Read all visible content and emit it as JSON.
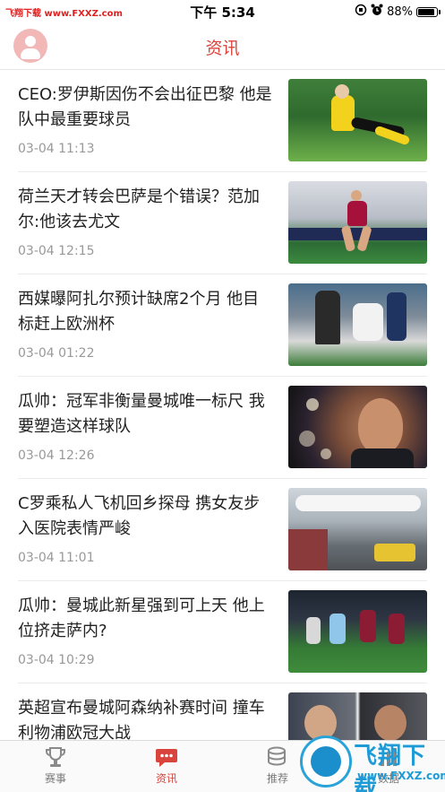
{
  "status_bar": {
    "watermark": "飞翔下载 www.FXXZ.com",
    "time": "下午 5:34",
    "battery": "88%",
    "battery_level": 0.88
  },
  "header": {
    "title": "资讯",
    "avatar_icon": "user-avatar-icon"
  },
  "news": [
    {
      "title": "CEO:罗伊斯因伤不会出征巴黎 他是队中最重要球员",
      "time": "03-04 11:13"
    },
    {
      "title": "荷兰天才转会巴萨是个错误？范加尔:他该去尤文",
      "time": "03-04 12:15"
    },
    {
      "title": "西媒曝阿扎尔预计缺席2个月 他目标赶上欧洲杯",
      "time": "03-04 01:22"
    },
    {
      "title": "瓜帅：冠军非衡量曼城唯一标尺 我要塑造这样球队",
      "time": "03-04 12:26"
    },
    {
      "title": "C罗乘私人飞机回乡探母 携女友步入医院表情严峻",
      "time": "03-04 11:01"
    },
    {
      "title": "瓜帅：曼城此新星强到可上天 他上位挤走萨内?",
      "time": "03-04 10:29"
    },
    {
      "title": "英超宣布曼城阿森纳补赛时间 撞车利物浦欧冠大战",
      "time": ""
    }
  ],
  "tabs": [
    {
      "label": "赛事",
      "icon": "trophy-icon",
      "active": false
    },
    {
      "label": "资讯",
      "icon": "chat-bubble-icon",
      "active": true
    },
    {
      "label": "推荐",
      "icon": "coins-icon",
      "active": false
    },
    {
      "label": "数据",
      "icon": "data-icon",
      "active": false
    }
  ],
  "watermark_logo": {
    "text": "飞翔下载",
    "url": "www.FXXZ.com"
  },
  "colors": {
    "accent": "#d9453d",
    "logo_blue": "#1e9bd7"
  }
}
